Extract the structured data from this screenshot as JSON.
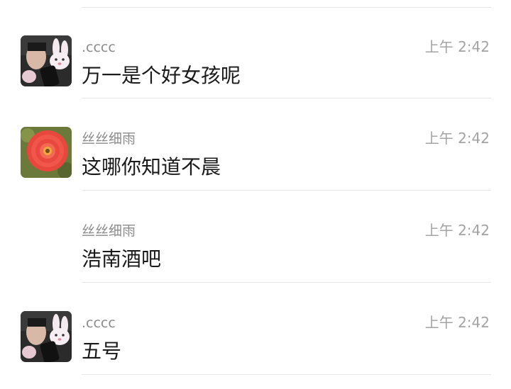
{
  "messages": [
    {
      "sender": ".cccc",
      "time": "上午 2:42",
      "text": "万一是个好女孩呢",
      "avatar": "rabbit-photo-avatar"
    },
    {
      "sender": "丝丝细雨",
      "time": "上午 2:42",
      "text": "这哪你知道不晨",
      "avatar": "red-flower-avatar"
    },
    {
      "sender": "丝丝细雨",
      "time": "上午 2:42",
      "text": "浩南酒吧",
      "avatar": ""
    },
    {
      "sender": ".cccc",
      "time": "上午 2:42",
      "text": "五号",
      "avatar": "rabbit-photo-avatar"
    }
  ]
}
